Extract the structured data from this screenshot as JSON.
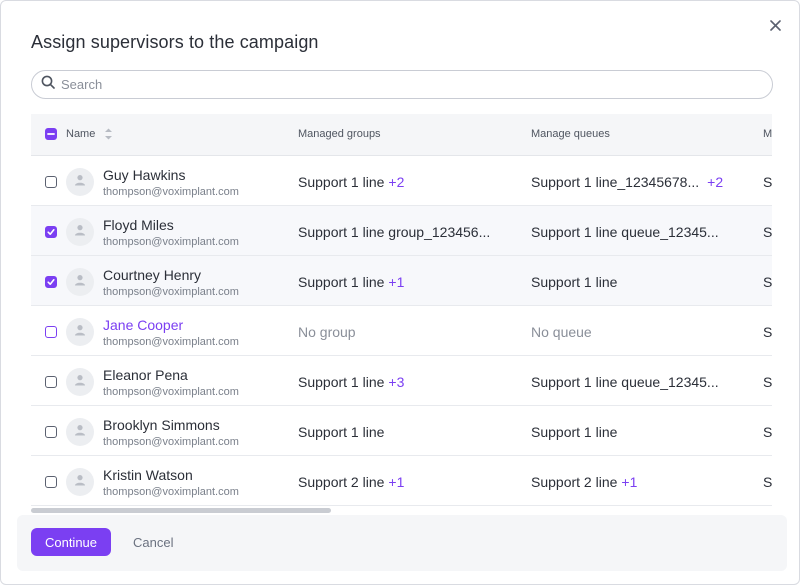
{
  "dialog": {
    "title": "Assign supervisors to the campaign",
    "close_icon": "close-icon"
  },
  "search": {
    "placeholder": "Search",
    "value": "",
    "icon": "search-icon"
  },
  "table": {
    "headers": {
      "name": "Name",
      "groups": "Managed groups",
      "queues": "Manage queues",
      "fourth": "M"
    },
    "select_all_state": "indeterminate",
    "sort_icon": "sort-icon",
    "rows": [
      {
        "checked": false,
        "name": "Guy Hawkins",
        "email": "thompson@voximplant.com",
        "group": "Support 1 line",
        "group_extra": "+2",
        "queue": "Support 1 line_12345678...",
        "queue_extra": "+2",
        "fourth": "S"
      },
      {
        "checked": true,
        "name": "Floyd Miles",
        "email": "thompson@voximplant.com",
        "group": "Support 1 line group_123456...",
        "group_extra": "",
        "queue": "Support 1 line queue_12345...",
        "queue_extra": "",
        "fourth": "S"
      },
      {
        "checked": true,
        "name": "Courtney Henry",
        "email": "thompson@voximplant.com",
        "group": "Support 1 line",
        "group_extra": "+1",
        "queue": "Support 1 line",
        "queue_extra": "",
        "fourth": "S"
      },
      {
        "checked": false,
        "name": "Jane Cooper",
        "email": "thompson@voximplant.com",
        "group": "No group",
        "group_extra": "",
        "queue": "No queue",
        "queue_extra": "",
        "fourth": "S"
      },
      {
        "checked": false,
        "name": "Eleanor Pena",
        "email": "thompson@voximplant.com",
        "group": "Support 1 line",
        "group_extra": "+3",
        "queue": "Support 1 line queue_12345...",
        "queue_extra": "",
        "fourth": "S"
      },
      {
        "checked": false,
        "name": "Brooklyn Simmons",
        "email": "thompson@voximplant.com",
        "group": "Support 1 line",
        "group_extra": "",
        "queue": "Support 1 line",
        "queue_extra": "",
        "fourth": "S"
      },
      {
        "checked": false,
        "name": "Kristin Watson",
        "email": "thompson@voximplant.com",
        "group": "Support 2 line",
        "group_extra": "+1",
        "queue": "Support 2 line",
        "queue_extra": "+1",
        "fourth": "S"
      }
    ]
  },
  "footer": {
    "continue_label": "Continue",
    "cancel_label": "Cancel"
  },
  "colors": {
    "accent": "#7b3ff2",
    "text": "#2b2f38",
    "muted": "#8a8f99"
  }
}
